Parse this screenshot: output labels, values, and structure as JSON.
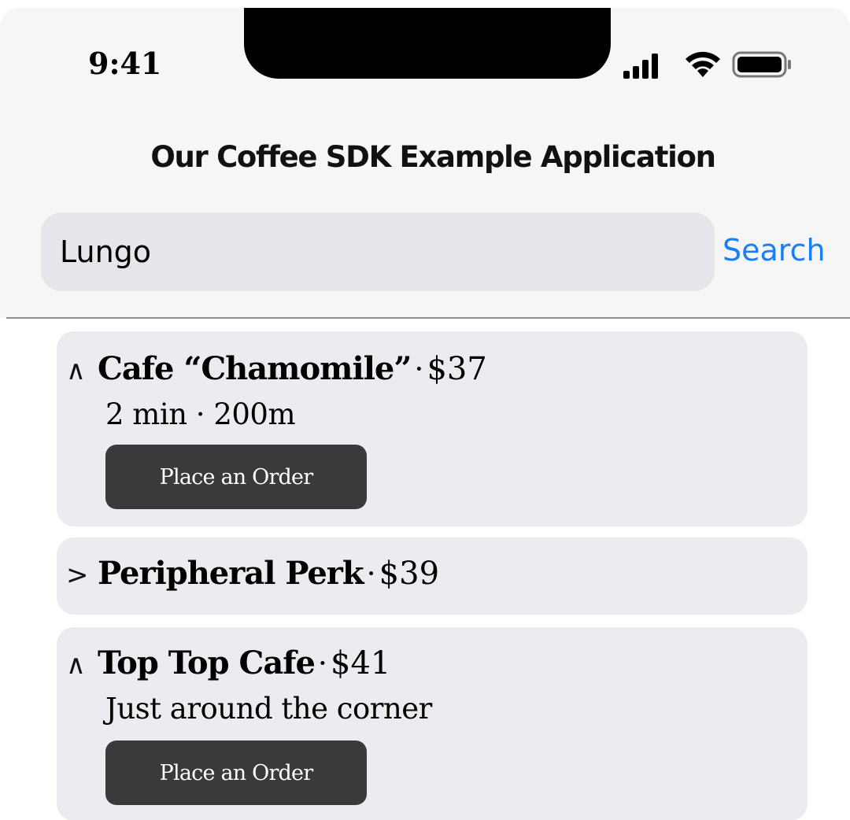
{
  "status_bar": {
    "time": "9:41",
    "signal_icon": "cellular-signal-icon",
    "wifi_icon": "wifi-icon",
    "battery_icon": "battery-icon"
  },
  "header": {
    "title": "Our Coffee SDK Example Application"
  },
  "search": {
    "value": "Lungo",
    "button_label": "Search"
  },
  "colors": {
    "accent": "#1a7ef5",
    "card_background": "#ebebf0",
    "button_background": "#3a3a3c"
  },
  "results": [
    {
      "expanded": true,
      "chevron": "∧",
      "name": "Cafe “Chamomile”",
      "separator": "·",
      "price": "$37",
      "detail": "2 min · 200m",
      "order_label": "Place an Order"
    },
    {
      "expanded": false,
      "chevron": ">",
      "name": "Peripheral Perk",
      "separator": "·",
      "price": "$39"
    },
    {
      "expanded": true,
      "chevron": "∧",
      "name": "Top Top Cafe",
      "separator": "·",
      "price": "$41",
      "detail": "Just around the corner",
      "order_label": "Place an Order"
    }
  ]
}
